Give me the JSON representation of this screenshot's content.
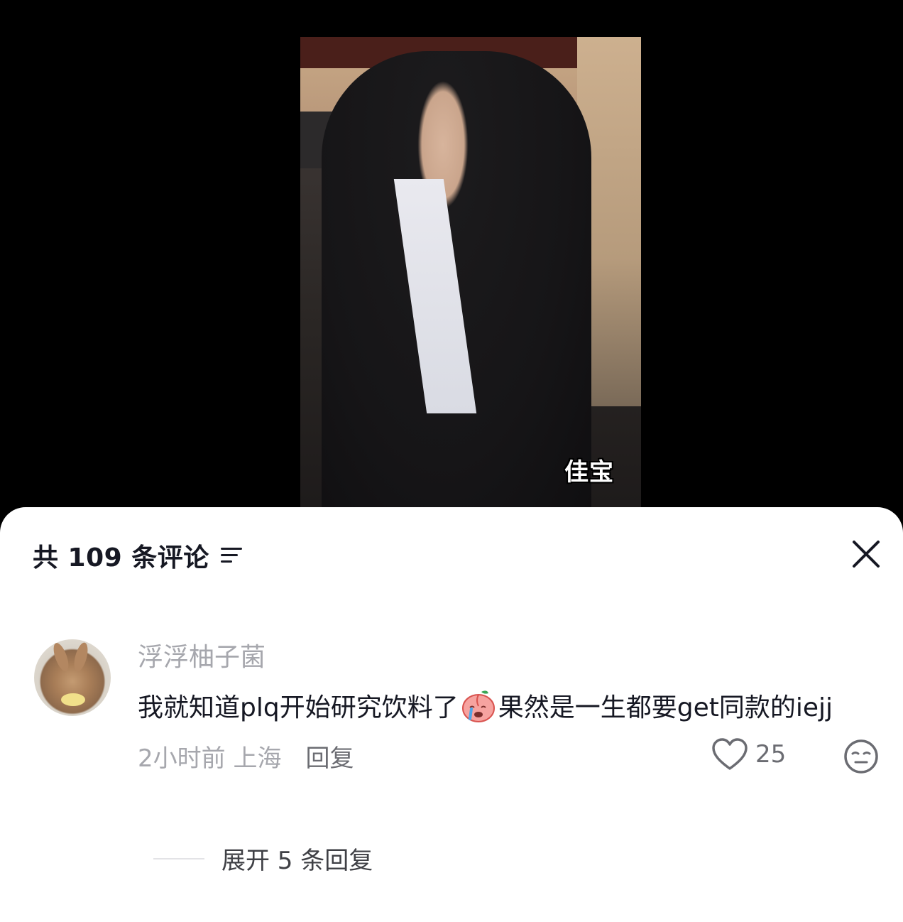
{
  "video": {
    "caption": "佳宝"
  },
  "sheet": {
    "title": "共 109 条评论",
    "sort_icon": "filter-lines-icon",
    "close_icon": "close-icon"
  },
  "comment": {
    "username": "浮浮柚子菌",
    "text_before_emoji": "我就知道plq开始研究饮料了",
    "emoji": "crying-peach-emoji",
    "text_after_emoji": "果然是一生都要get同款的iejj",
    "time_location": "2小时前 上海",
    "reply_label": "回复",
    "like_count": "25",
    "like_icon": "heart-icon",
    "dislike_icon": "meh-face-icon"
  },
  "replies": {
    "expand_label": "展开 5 条回复"
  },
  "colors": {
    "primary_text": "#161823",
    "secondary_text": "#a6a7ad",
    "sheet_bg": "#ffffff",
    "backdrop": "#000000"
  }
}
